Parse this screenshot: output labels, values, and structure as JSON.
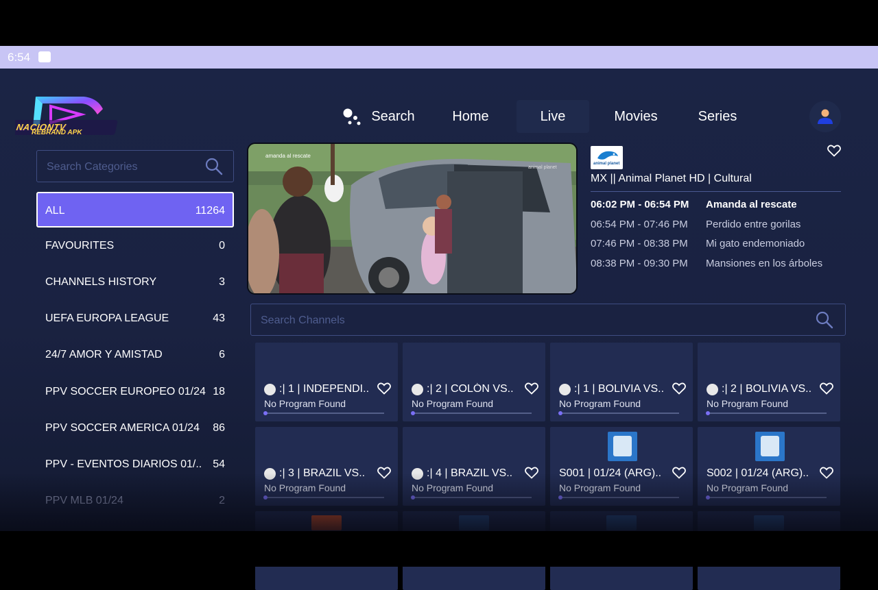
{
  "status": {
    "time": "6:54"
  },
  "logo": {
    "line1": "NACIONTV",
    "line2": "REBRAND APK"
  },
  "nav": {
    "search": "Search",
    "home": "Home",
    "live": "Live",
    "movies": "Movies",
    "series": "Series"
  },
  "categories": {
    "placeholder": "Search Categories",
    "items": [
      {
        "name": "ALL",
        "count": "11264"
      },
      {
        "name": "FAVOURITES",
        "count": "0"
      },
      {
        "name": "CHANNELS HISTORY",
        "count": "3"
      },
      {
        "name": "UEFA EUROPA LEAGUE",
        "count": "43"
      },
      {
        "name": "24/7 AMOR Y AMISTAD",
        "count": "6"
      },
      {
        "name": "PPV SOCCER EUROPEO 01/24",
        "count": "18"
      },
      {
        "name": "PPV SOCCER AMERICA 01/24",
        "count": "86"
      },
      {
        "name": "PPV - EVENTOS DIARIOS 01/..",
        "count": "54"
      },
      {
        "name": "PPV MLB 01/24",
        "count": "2"
      }
    ]
  },
  "player": {
    "overlay_left": "amanda al rescate",
    "overlay_right": "animal planet"
  },
  "epg": {
    "logo_text": "animal planet",
    "channel": "MX || Animal Planet HD | Cultural",
    "programs": [
      {
        "time": "06:02 PM - 06:54 PM",
        "title": "Amanda al rescate"
      },
      {
        "time": "06:54 PM - 07:46 PM",
        "title": "Perdido entre gorilas"
      },
      {
        "time": "07:46 PM - 08:38 PM",
        "title": "Mi gato endemoniado"
      },
      {
        "time": "08:38 PM - 09:30 PM",
        "title": "Mansiones en los árboles"
      }
    ]
  },
  "channels": {
    "placeholder": "Search Channels",
    "items": [
      {
        "title": ":| 1 | INDEPENDI..",
        "sub": "No Program Found"
      },
      {
        "title": ":| 2 | COLÓN VS..",
        "sub": "No Program Found"
      },
      {
        "title": ":| 1 | BOLIVIA VS..",
        "sub": "No Program Found"
      },
      {
        "title": ":| 2 | BOLIVIA VS..",
        "sub": "No Program Found"
      },
      {
        "title": ":| 3 | BRAZIL VS..",
        "sub": "No Program Found"
      },
      {
        "title": ":| 4 | BRAZIL VS..",
        "sub": "No Program Found"
      },
      {
        "title": "S001 | 01/24 (ARG)..",
        "sub": "No Program Found"
      },
      {
        "title": "S002 | 01/24 (ARG)..",
        "sub": "No Program Found"
      }
    ]
  },
  "colors": {
    "accent": "#6f63f2",
    "background": "#1b2445",
    "card": "#222c52"
  }
}
